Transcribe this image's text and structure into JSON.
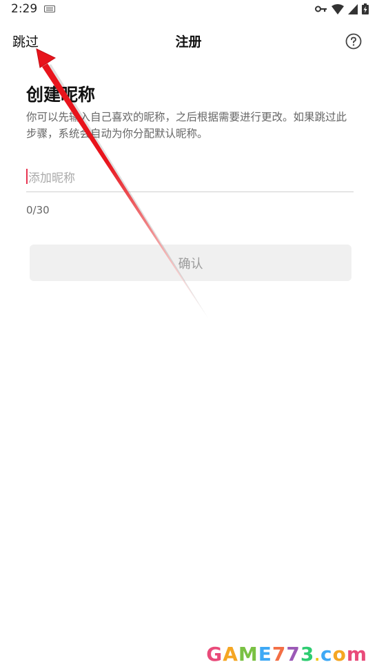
{
  "status_bar": {
    "time": "2:29"
  },
  "header": {
    "skip_label": "跳过",
    "title": "注册"
  },
  "content": {
    "heading": "创建昵称",
    "description": "你可以先输入自己喜欢的昵称，之后根据需要进行更改。如果跳过此步骤，系统会自动为你分配默认昵称。",
    "nickname_placeholder": "添加昵称",
    "nickname_value": "",
    "counter": "0/30",
    "confirm_label": "确认"
  },
  "annotation": {
    "arrow_color": "#e8141c"
  },
  "colors": {
    "caret": "#e8324f",
    "confirm_bg": "#f0f0f0",
    "confirm_text": "#9a9a9a"
  },
  "watermark": {
    "text": "GAME773.com"
  }
}
